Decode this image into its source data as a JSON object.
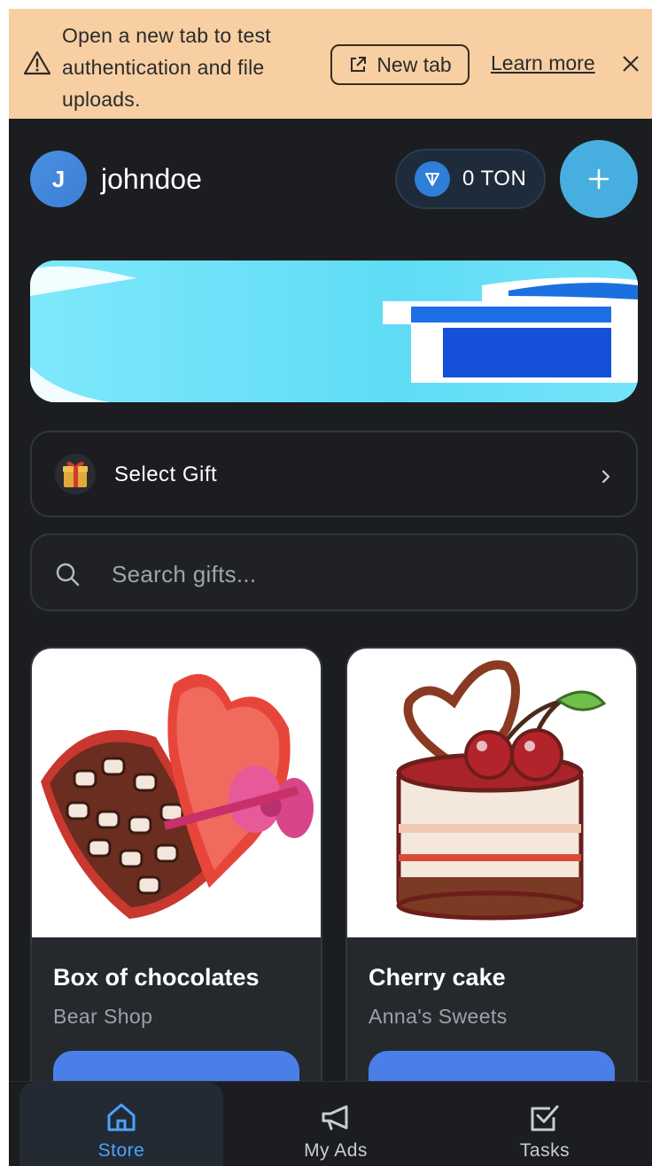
{
  "banner": {
    "message": "Open a new tab to test authentication and file uploads.",
    "new_tab_label": "New tab",
    "learn_more_label": "Learn more",
    "icons": {
      "warning": "warning-triangle-icon",
      "external": "external-link-icon",
      "close": "close-icon"
    }
  },
  "header": {
    "avatar_initial": "J",
    "username": "johndoe",
    "balance": "0 TON",
    "add_icon": "plus-icon"
  },
  "select_gift": {
    "label": "Select Gift",
    "icon": "gift-icon"
  },
  "search": {
    "placeholder": "Search gifts..."
  },
  "gifts": [
    {
      "name": "Box of chocolates",
      "shop": "Bear Shop"
    },
    {
      "name": "Cherry cake",
      "shop": "Anna's Sweets"
    }
  ],
  "nav": {
    "items": [
      {
        "label": "Store",
        "icon": "home-icon",
        "active": true
      },
      {
        "label": "My Ads",
        "icon": "megaphone-icon",
        "active": false
      },
      {
        "label": "Tasks",
        "icon": "checkbox-icon",
        "active": false
      }
    ]
  },
  "colors": {
    "accent": "#4a7fe8",
    "banner_bg": "#f7cfa2",
    "app_bg": "#1b1d21",
    "active_nav": "#4aa3ff"
  }
}
